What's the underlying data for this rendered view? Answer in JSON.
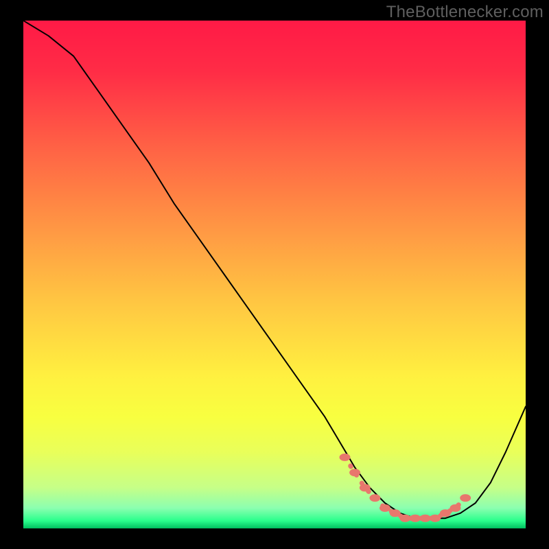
{
  "watermark": "TheBottlenecker.com",
  "chart_data": {
    "type": "line",
    "title": "",
    "xlabel": "",
    "ylabel": "",
    "xlim": [
      0,
      100
    ],
    "ylim": [
      0,
      100
    ],
    "background": {
      "type": "vertical-gradient",
      "stops": [
        {
          "pos": 0.0,
          "color": "#ff1a46"
        },
        {
          "pos": 0.1,
          "color": "#ff2c46"
        },
        {
          "pos": 0.25,
          "color": "#ff6245"
        },
        {
          "pos": 0.4,
          "color": "#ff9444"
        },
        {
          "pos": 0.55,
          "color": "#ffc542"
        },
        {
          "pos": 0.7,
          "color": "#fff040"
        },
        {
          "pos": 0.78,
          "color": "#f8ff40"
        },
        {
          "pos": 0.85,
          "color": "#e9ff5a"
        },
        {
          "pos": 0.92,
          "color": "#c6ff88"
        },
        {
          "pos": 0.96,
          "color": "#8bffb0"
        },
        {
          "pos": 0.985,
          "color": "#2aff8c"
        },
        {
          "pos": 1.0,
          "color": "#00c060"
        }
      ]
    },
    "series": [
      {
        "name": "bottleneck-curve",
        "color": "#000000",
        "stroke_width": 2,
        "x": [
          0,
          5,
          10,
          15,
          20,
          25,
          30,
          35,
          40,
          45,
          50,
          55,
          60,
          63,
          66,
          69,
          72,
          75,
          78,
          81,
          84,
          87,
          90,
          93,
          96,
          100
        ],
        "y": [
          100,
          97,
          93,
          86,
          79,
          72,
          64,
          57,
          50,
          43,
          36,
          29,
          22,
          17,
          12,
          8,
          5,
          3,
          2,
          2,
          2,
          3,
          5,
          9,
          15,
          24
        ]
      }
    ],
    "marker_band": {
      "name": "optimal-range-dots",
      "color": "#e8776d",
      "style": "dotted",
      "x": [
        64,
        66,
        68,
        70,
        72,
        74,
        76,
        78,
        80,
        82,
        84,
        86,
        88
      ],
      "y": [
        14,
        11,
        8,
        6,
        4,
        3,
        2,
        2,
        2,
        2,
        3,
        4,
        6
      ]
    }
  }
}
